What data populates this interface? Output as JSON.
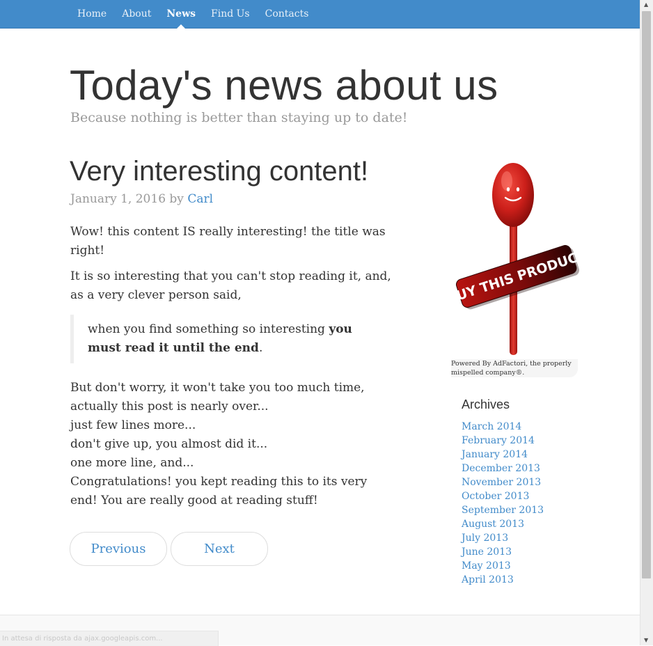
{
  "nav": {
    "items": [
      {
        "label": "Home",
        "active": false
      },
      {
        "label": "About",
        "active": false
      },
      {
        "label": "News",
        "active": true
      },
      {
        "label": "Find Us",
        "active": false
      },
      {
        "label": "Contacts",
        "active": false
      }
    ]
  },
  "header": {
    "title": "Today's news about us",
    "description": "Because nothing is better than staying up to date!"
  },
  "post": {
    "title": "Very interesting content!",
    "date": "January 1, 2016",
    "by": "by",
    "author": "Carl",
    "p1": "Wow! this content IS really interesting! the title was right!",
    "p2": "It is so interesting that you can't stop reading it, and, as a very clever person said,",
    "quote_normal": "when you find something so interesting ",
    "quote_bold": "you must read it until the end",
    "quote_end": ".",
    "lines": [
      "But don't worry, it won't take you too much time, actually this post is nearly over...",
      "just few lines more...",
      "don't give up, you almost did it...",
      "one more line, and...",
      "Congratulations! you kept reading this to its very end! You are really good at reading stuff!"
    ]
  },
  "pager": {
    "previous": "Previous",
    "next": "Next"
  },
  "ad": {
    "banner_text": "BUY THIS PRODUCT",
    "caption": "Powered By AdFactori, the properly mispelled company®.",
    "spoon_color": "#cc1f1a",
    "banner_color": "#7a0a0a"
  },
  "archives": {
    "title": "Archives",
    "items": [
      "March 2014",
      "February 2014",
      "January 2014",
      "December 2013",
      "November 2013",
      "October 2013",
      "September 2013",
      "August 2013",
      "July 2013",
      "June 2013",
      "May 2013",
      "April 2013"
    ]
  },
  "status": {
    "text": "In attesa di risposta da ajax.googleapis.com..."
  },
  "colors": {
    "nav_bg": "#428bca",
    "link": "#428bca",
    "muted": "#999999"
  }
}
